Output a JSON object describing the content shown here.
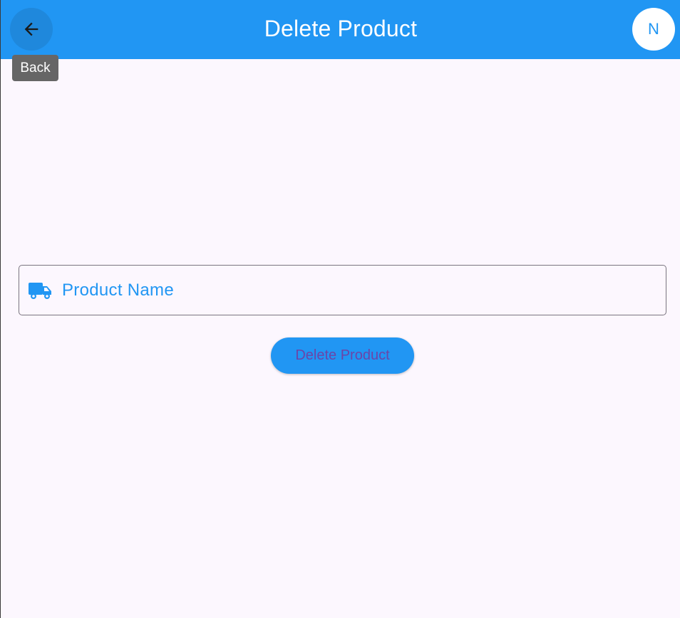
{
  "appbar": {
    "title": "Delete Product",
    "back_icon": "arrow-left-icon",
    "avatar_initial": "N",
    "color": "#2196F3"
  },
  "tooltip": {
    "text": "Back"
  },
  "form": {
    "product_field": {
      "label": "Product Name",
      "value": "",
      "icon": "truck-icon"
    },
    "delete_button_label": "Delete Product"
  },
  "colors": {
    "primary": "#2196F3",
    "background": "#FCF7FE",
    "button_text": "#6B45A8"
  }
}
